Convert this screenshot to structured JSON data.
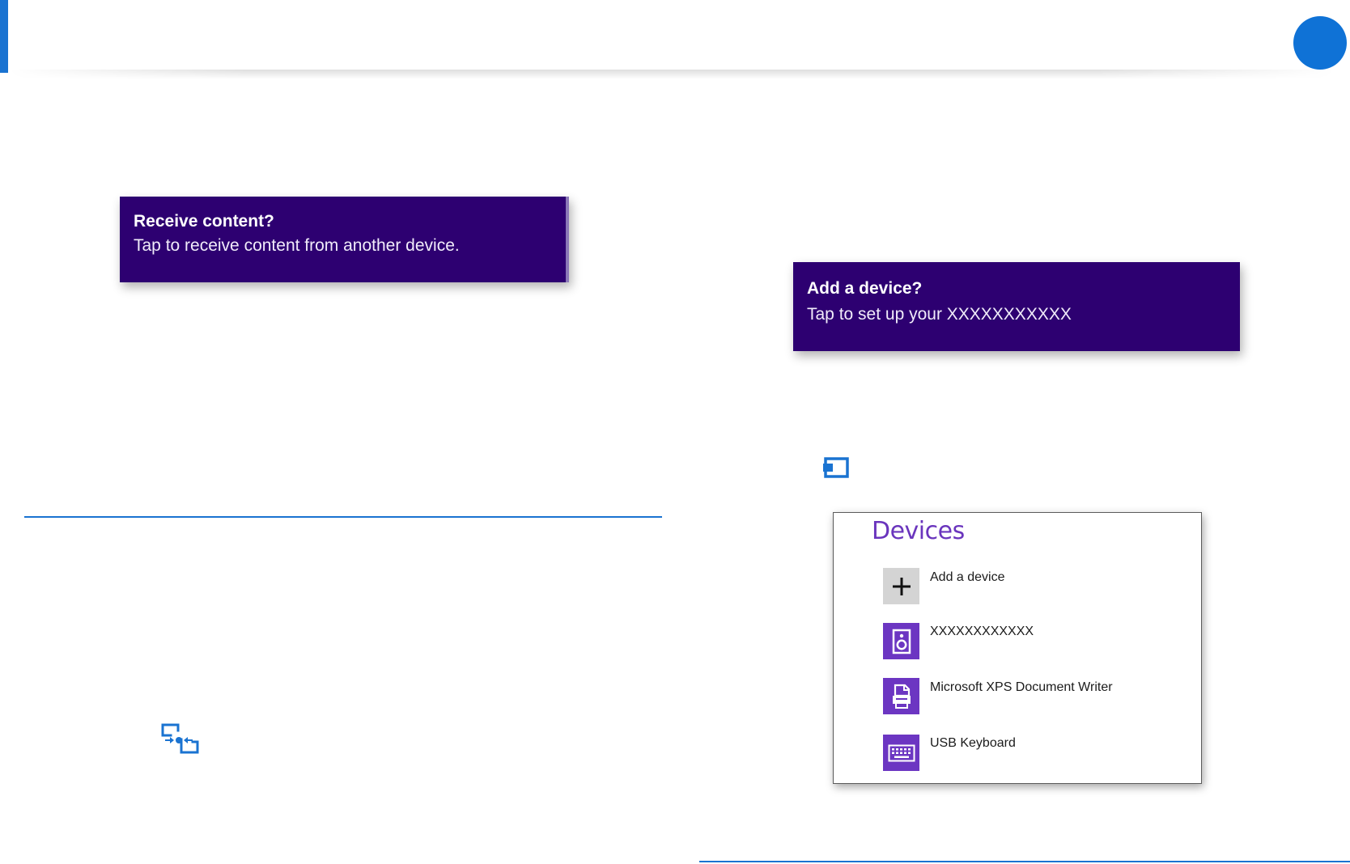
{
  "receive_toast": {
    "title": "Receive content?",
    "body": "Tap to receive content from another device."
  },
  "add_device_toast": {
    "title": "Add a device?",
    "body": "Tap to set up your XXXXXXXXXXX"
  },
  "devices_panel": {
    "title": "Devices",
    "items": [
      {
        "label": "Add a device",
        "icon": "plus-icon"
      },
      {
        "label": "XXXXXXXXXXXX",
        "icon": "speaker-icon"
      },
      {
        "label": "Microsoft XPS Document Writer",
        "icon": "printer-icon"
      },
      {
        "label": "USB Keyboard",
        "icon": "keyboard-icon"
      }
    ]
  },
  "icons": {
    "share_icon": "share-icon",
    "project_icon": "project-icon"
  },
  "colors": {
    "accent_blue": "#1a73d1",
    "toast_bg": "#2d0071",
    "tile_purple": "#6c36c2",
    "panel_title": "#6a35bd"
  }
}
